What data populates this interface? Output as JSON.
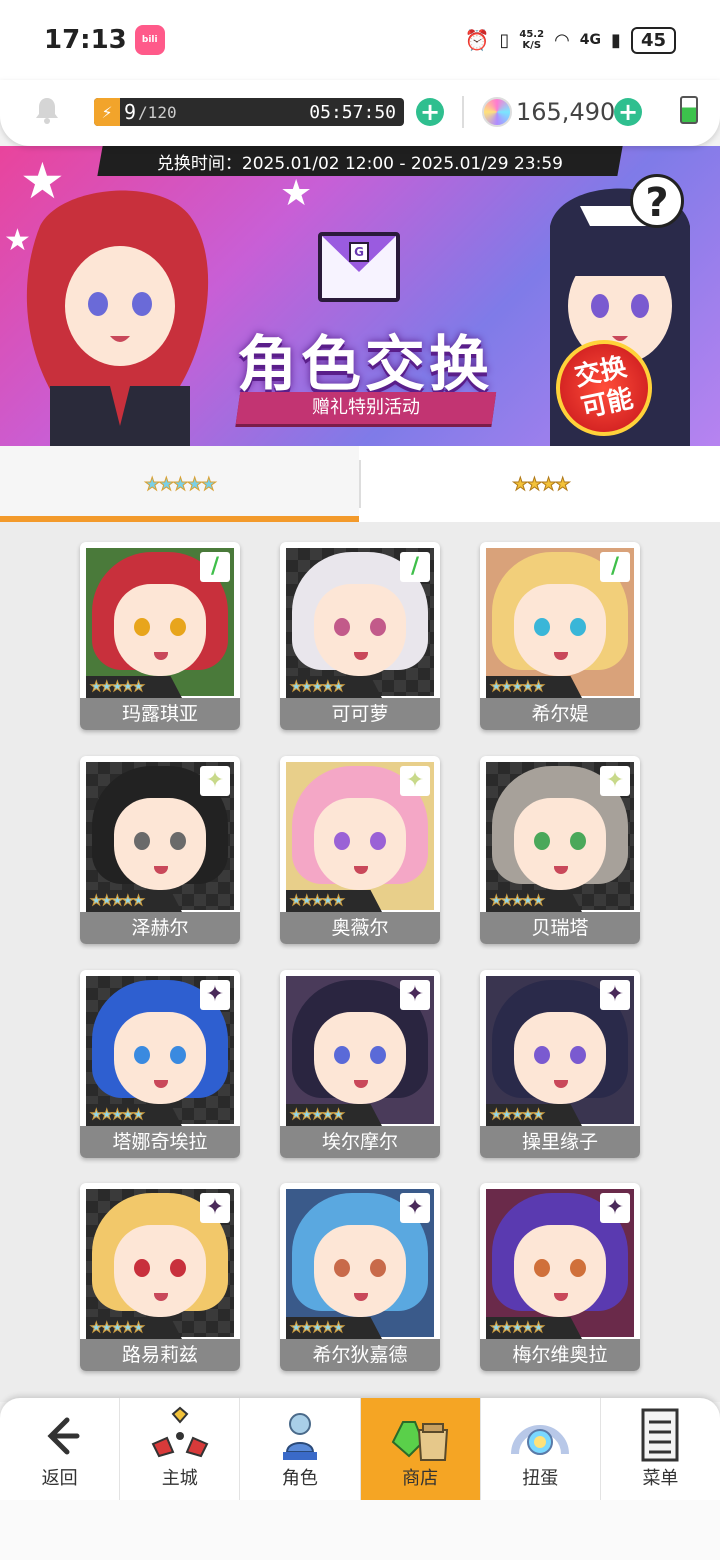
{
  "status_bar": {
    "time": "17:13",
    "app_badge": "bili",
    "net_speed_top": "45.2",
    "net_speed_unit": "K/S",
    "network": "4G",
    "battery": "45"
  },
  "top_bar": {
    "energy": "9",
    "energy_max": "/120",
    "energy_timer": "05:57:50",
    "gems": "165,490"
  },
  "banner": {
    "exchange_time": "兑换时间：2025.01/02 12:00 - 2025.01/29 23:59",
    "title": "角色交换",
    "subtitle": "赠礼特别活动",
    "badge": "交换可能",
    "help": "?",
    "envelope_letter": "G"
  },
  "tabs": [
    {
      "label": "★★★★★",
      "rarity": 5,
      "active": true
    },
    {
      "label": "★★★★",
      "rarity": 4,
      "active": false
    }
  ],
  "rarity_stars": "★★★★★",
  "characters": [
    {
      "name": "玛露琪亚",
      "element": "wind",
      "element_glyph": "/",
      "element_color": "#3fbf4a",
      "hair": "#c8303c",
      "eye": "#e8a51c",
      "bg": "#4a7a3a"
    },
    {
      "name": "可可萝",
      "element": "wind",
      "element_glyph": "/",
      "element_color": "#3fbf4a",
      "hair": "#e9e6ec",
      "eye": "#c25a8a",
      "bg": "checker"
    },
    {
      "name": "希尔媞",
      "element": "wind",
      "element_glyph": "/",
      "element_color": "#3fbf4a",
      "hair": "#f2cf7a",
      "eye": "#3ab6d8",
      "bg": "#d9a27a"
    },
    {
      "name": "泽赫尔",
      "element": "light",
      "element_glyph": "✦",
      "element_color": "#c8d98a",
      "hair": "#222222",
      "eye": "#6a6a6a",
      "bg": "checker"
    },
    {
      "name": "奥薇尔",
      "element": "light",
      "element_glyph": "✦",
      "element_color": "#c8d98a",
      "hair": "#f4a7c6",
      "eye": "#9a62d6",
      "bg": "#e8cf8a"
    },
    {
      "name": "贝瑞塔",
      "element": "light",
      "element_glyph": "✦",
      "element_color": "#c8d98a",
      "hair": "#a7a19a",
      "eye": "#4aa85a",
      "bg": "checker"
    },
    {
      "name": "塔娜奇埃拉",
      "element": "dark",
      "element_glyph": "✦",
      "element_color": "#4a2a5a",
      "hair": "#2e5fd0",
      "eye": "#3a8ae0",
      "bg": "checker"
    },
    {
      "name": "埃尔摩尔",
      "element": "dark",
      "element_glyph": "✦",
      "element_color": "#4a2a5a",
      "hair": "#2a2540",
      "eye": "#5a6ad8",
      "bg": "#4a3b5a"
    },
    {
      "name": "操里缘子",
      "element": "dark",
      "element_glyph": "✦",
      "element_color": "#4a2a5a",
      "hair": "#2a2a4a",
      "eye": "#7a5ad0",
      "bg": "#3a3550"
    },
    {
      "name": "路易莉兹",
      "element": "dark",
      "element_glyph": "✦",
      "element_color": "#4a2a5a",
      "hair": "#f2c86a",
      "eye": "#c8303c",
      "bg": "checker"
    },
    {
      "name": "希尔狄嘉德",
      "element": "dark",
      "element_glyph": "✦",
      "element_color": "#4a2a5a",
      "hair": "#5aa8e0",
      "eye": "#c86a4a",
      "bg": "#3a5a8a"
    },
    {
      "name": "梅尔维奥拉",
      "element": "dark",
      "element_glyph": "✦",
      "element_color": "#4a2a5a",
      "hair": "#5a3ab0",
      "eye": "#d0703a",
      "bg": "#6a2a4a"
    }
  ],
  "bottom_nav": [
    {
      "label": "返回",
      "icon": "back-arrow-icon",
      "active": false
    },
    {
      "label": "主城",
      "icon": "castle-icon",
      "active": false
    },
    {
      "label": "角色",
      "icon": "character-icon",
      "active": false
    },
    {
      "label": "商店",
      "icon": "shop-icon",
      "active": true
    },
    {
      "label": "扭蛋",
      "icon": "gacha-icon",
      "active": false
    },
    {
      "label": "菜单",
      "icon": "menu-icon",
      "active": false
    }
  ],
  "colors": {
    "accent": "#f39a2b",
    "plus_button": "#2fbf8f",
    "active_nav": "#f5a524"
  }
}
